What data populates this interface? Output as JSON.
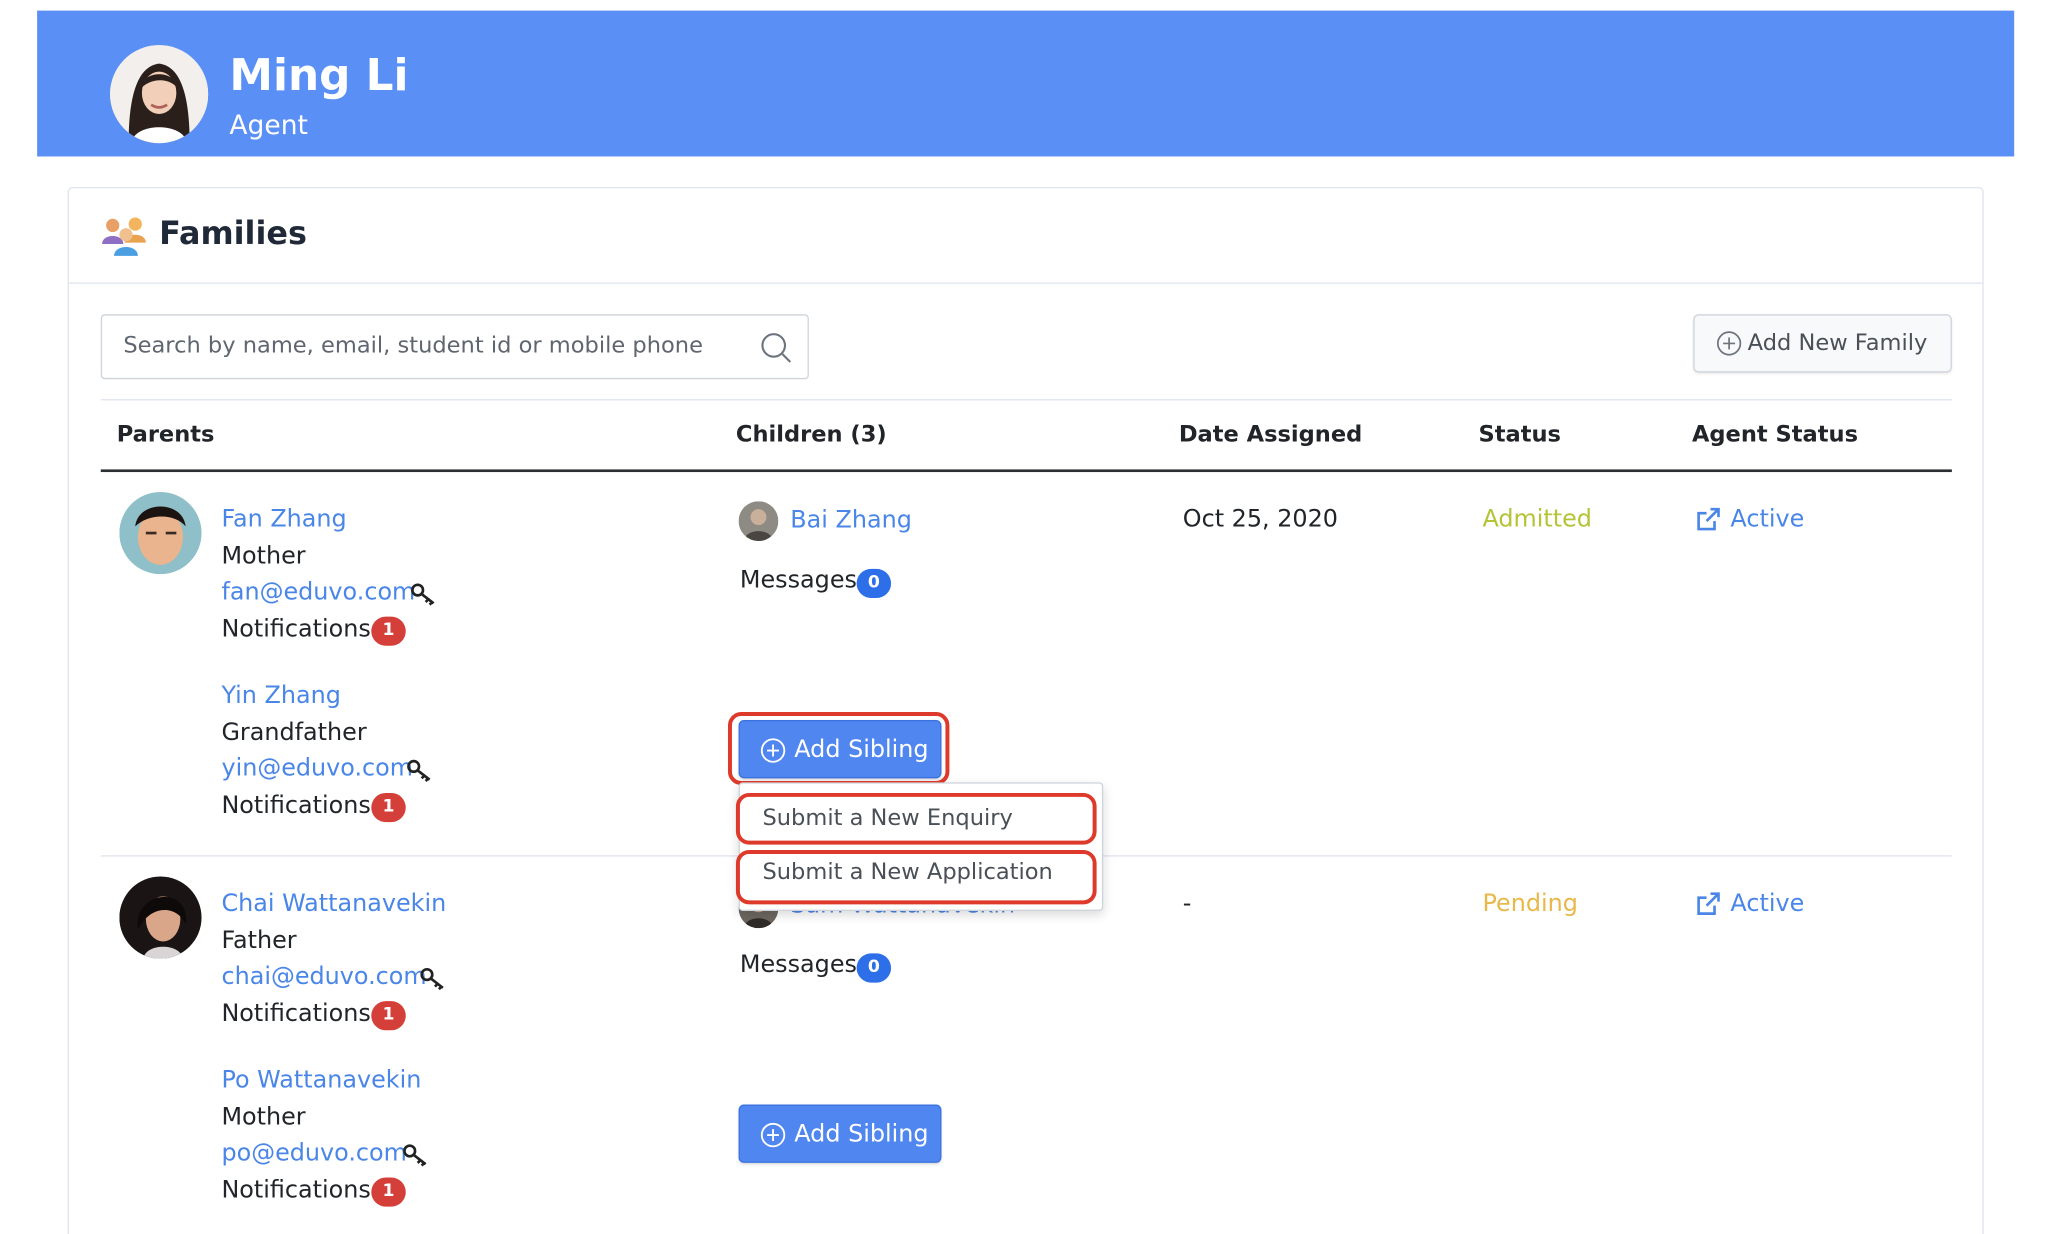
{
  "header": {
    "name": "Ming Li",
    "role": "Agent",
    "color": "#5a8ff6"
  },
  "section": {
    "title": "Families",
    "icon": "families-icon"
  },
  "search": {
    "placeholder": "Search by name, email, student id or mobile phone",
    "icon": "search-icon"
  },
  "add_family": {
    "label": "Add New Family",
    "icon": "plus-circle-icon"
  },
  "table": {
    "columns": [
      "Parents",
      "Children (3)",
      "Date Assigned",
      "Status",
      "Agent Status"
    ],
    "rows": [
      {
        "parents": [
          {
            "name": "Fan Zhang",
            "relation": "Mother",
            "email": "fan@eduvo.com",
            "notifications_label": "Notifications",
            "notifications": "1"
          },
          {
            "name": "Yin Zhang",
            "relation": "Grandfather",
            "email": "yin@eduvo.com",
            "notifications_label": "Notifications",
            "notifications": "1"
          }
        ],
        "child": {
          "name": "Bai Zhang",
          "messages_label": "Messages",
          "messages": "0"
        },
        "date_assigned": "Oct 25, 2020",
        "status": "Admitted",
        "status_color": "#b5c437",
        "agent_status": "Active",
        "add_sibling": "Add Sibling"
      },
      {
        "parents": [
          {
            "name": "Chai Wattanavekin",
            "relation": "Father",
            "email": "chai@eduvo.com",
            "notifications_label": "Notifications",
            "notifications": "1"
          },
          {
            "name": "Po Wattanavekin",
            "relation": "Mother",
            "email": "po@eduvo.com",
            "notifications_label": "Notifications",
            "notifications": "1"
          }
        ],
        "child": {
          "name": "Sam Wattanavekin",
          "messages_label": "Messages",
          "messages": "0"
        },
        "date_assigned": "-",
        "status": "Pending",
        "status_color": "#e8b94a",
        "agent_status": "Active",
        "add_sibling": "Add Sibling"
      }
    ]
  },
  "dropdown": {
    "items": [
      "Submit a New Enquiry",
      "Submit a New Application"
    ]
  },
  "colors": {
    "link": "#4a86e8",
    "highlight": "#de3a2b",
    "badge_red": "#d43f3a",
    "badge_blue": "#2d6fe8"
  }
}
